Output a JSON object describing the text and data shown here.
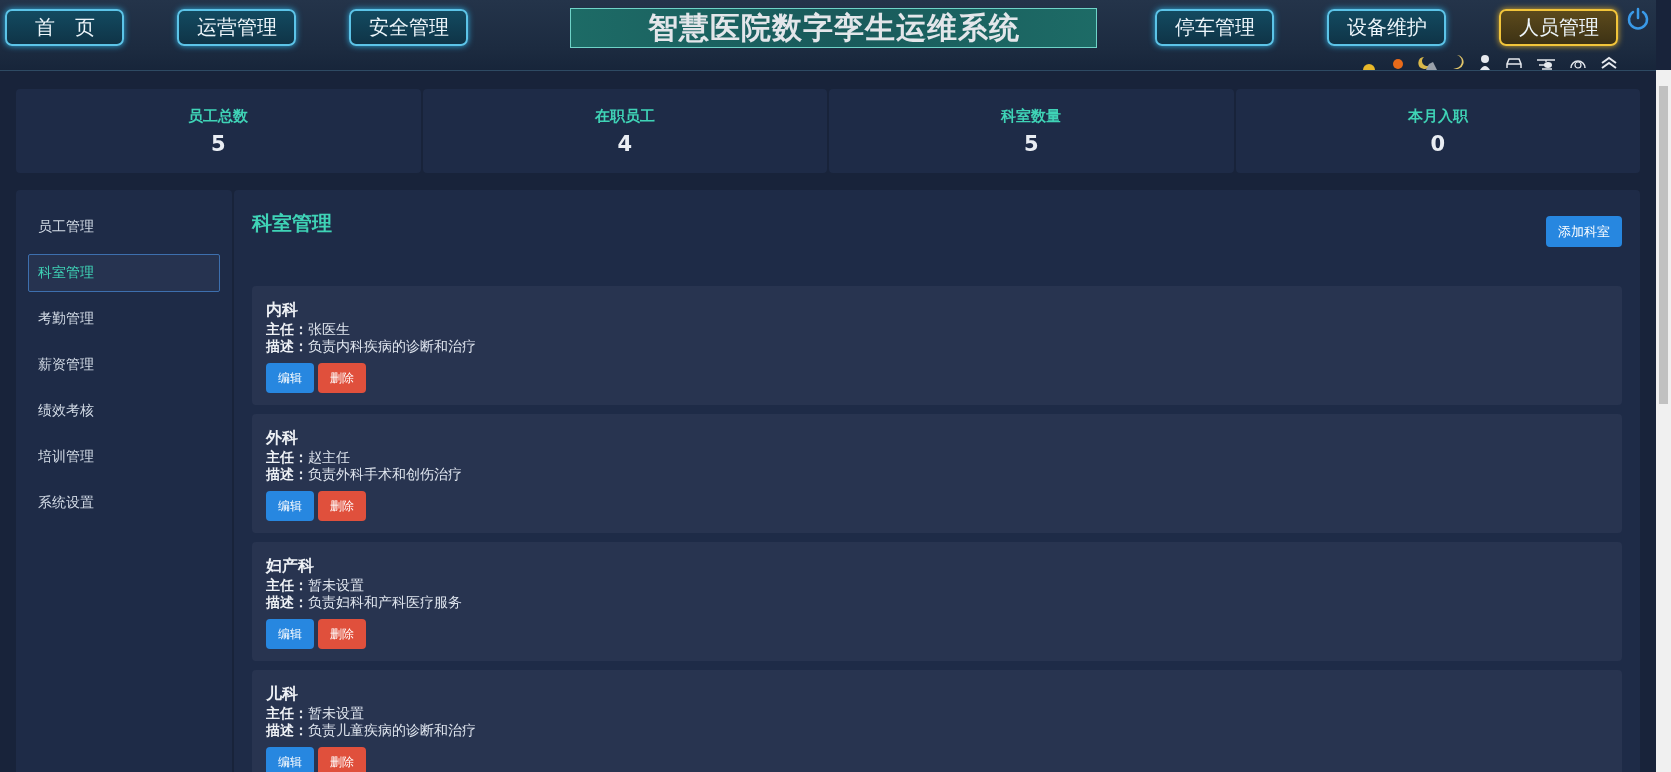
{
  "header": {
    "title": "智慧医院数字孪生运维系统",
    "nav_left": [
      {
        "label": "首　页",
        "selected": false
      },
      {
        "label": "运营管理",
        "selected": false
      },
      {
        "label": "安全管理",
        "selected": false
      }
    ],
    "nav_right": [
      {
        "label": "停车管理",
        "selected": false
      },
      {
        "label": "设备维护",
        "selected": false
      },
      {
        "label": "人员管理",
        "selected": true
      }
    ]
  },
  "stats": [
    {
      "label": "员工总数",
      "value": "5"
    },
    {
      "label": "在职员工",
      "value": "4"
    },
    {
      "label": "科室数量",
      "value": "5"
    },
    {
      "label": "本月入职",
      "value": "0"
    }
  ],
  "sidebar": {
    "items": [
      {
        "label": "员工管理",
        "selected": false
      },
      {
        "label": "科室管理",
        "selected": true
      },
      {
        "label": "考勤管理",
        "selected": false
      },
      {
        "label": "薪资管理",
        "selected": false
      },
      {
        "label": "绩效考核",
        "selected": false
      },
      {
        "label": "培训管理",
        "selected": false
      },
      {
        "label": "系统设置",
        "selected": false
      }
    ]
  },
  "content": {
    "title": "科室管理",
    "add_button": "添加科室",
    "departments": [
      {
        "name": "内科",
        "head": "**主任：**张医生",
        "description": "**描述：**负责内科疾病的诊断和治疗",
        "edit": "编辑",
        "delete": "删除"
      },
      {
        "name": "外科",
        "head": "**主任：**赵主任",
        "description": "**描述：**负责外科手术和创伤治疗",
        "edit": "编辑",
        "delete": "删除"
      },
      {
        "name": "妇产科",
        "head": "**主任：**暂未设置",
        "description": "**描述：**负责妇科和产科医疗服务",
        "edit": "编辑",
        "delete": "删除"
      },
      {
        "name": "儿科",
        "head": "**主任：**暂未设置",
        "description": "**描述：**负责儿童疾病的诊断和治疗",
        "edit": "编辑",
        "delete": "删除"
      }
    ]
  }
}
